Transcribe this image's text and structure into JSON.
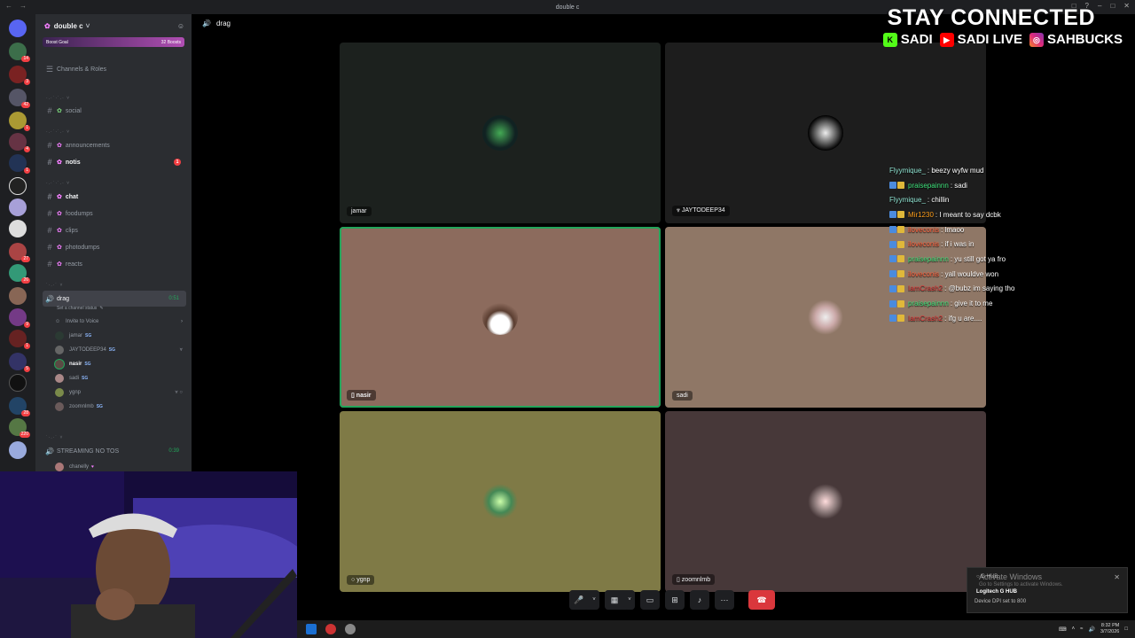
{
  "window": {
    "title": "double c"
  },
  "servers": [
    {
      "badge": ""
    },
    {
      "badge": "14"
    },
    {
      "badge": "3"
    },
    {
      "badge": "42"
    },
    {
      "badge": "1"
    },
    {
      "badge": "4"
    },
    {
      "badge": "1"
    },
    {
      "badge": ""
    },
    {
      "badge": "27"
    },
    {
      "badge": "26"
    },
    {
      "badge": ""
    },
    {
      "badge": "9"
    },
    {
      "badge": "1"
    },
    {
      "badge": "5"
    },
    {
      "badge": "8"
    },
    {
      "badge": "28"
    },
    {
      "badge": ""
    },
    {
      "badge": "220"
    },
    {
      "badge": "12"
    }
  ],
  "sidebar": {
    "guild_name": "double c",
    "boost_left": "Boost Goal",
    "boost_right": "32 Boosts",
    "channels_roles": "Channels & Roles",
    "channels": {
      "social": "social",
      "announcements": "announcements",
      "notis": "notis",
      "notis_mentions": "1",
      "chat": "chat",
      "foodumps": "foodumps",
      "clips": "clips",
      "photodumps": "photodumps",
      "reacts": "reacts"
    },
    "voice": {
      "name": "drag",
      "timer": "0:51",
      "status_prompt": "Set a channel status",
      "invite": "Invite to Voice",
      "members": [
        {
          "name": "jamar",
          "tag": "SG"
        },
        {
          "name": "JAYTODEEP34",
          "tag": "SG"
        },
        {
          "name": "nasir",
          "tag": "SG"
        },
        {
          "name": "sadi",
          "tag": "SG"
        },
        {
          "name": "ygnp",
          "tag": ""
        },
        {
          "name": "zoomnlmb",
          "tag": "SG"
        }
      ]
    },
    "voice2": {
      "name": "STREAMING NO TOS",
      "timer": "0:39",
      "member": "chanelly"
    }
  },
  "call": {
    "channel": "drag",
    "tiles": [
      {
        "name": "jamar",
        "bg": "#1c211e"
      },
      {
        "name": "JAYTODEEP34",
        "bg": "#1d1d1d"
      },
      {
        "name": "nasir",
        "bg": "#8c6b5d"
      },
      {
        "name": "sadi",
        "bg": "#8f7766"
      },
      {
        "name": "ygnp",
        "bg": "#7f7a46"
      },
      {
        "name": "zoomnlmb",
        "bg": "#473839"
      }
    ]
  },
  "overlay": {
    "headline": "STAY CONNECTED",
    "kick": "SADI",
    "youtube": "SADI LIVE",
    "instagram": "SAHBUCKS"
  },
  "chat": [
    {
      "user": "Flyymique_",
      "text": ": beezy wyfw mud",
      "color": "#8fe3d1"
    },
    {
      "user": "praisepainnn",
      "text": ": sadi",
      "color": "#3ee07a"
    },
    {
      "user": "Flyymique_",
      "text": ": chillin",
      "color": "#8fe3d1"
    },
    {
      "user": "Mir1230",
      "text": ": I meant to say dcbk",
      "color": "#ff9f1c"
    },
    {
      "user": "iloveconis",
      "text": ": lmaoo",
      "color": "#ff5e3a"
    },
    {
      "user": "iloveconis",
      "text": ": if i was in",
      "color": "#ff5e3a"
    },
    {
      "user": "praisepainnn",
      "text": ": yu still got ya fro",
      "color": "#3ee07a"
    },
    {
      "user": "iloveconis",
      "text": ": yall wouldve won",
      "color": "#ff5e3a"
    },
    {
      "user": "IamCrash2",
      "text": ": @bubz im saying tho",
      "color": "#e03a3a"
    },
    {
      "user": "praisepainnn",
      "text": ": give it to me",
      "color": "#3ee07a"
    },
    {
      "user": "IamCrash2",
      "text": ": ifg u are....",
      "color": "#e03a3a"
    }
  ],
  "toast": {
    "app": "G HUB",
    "title": "Logitech G HUB",
    "body": "Device DPI set to 800"
  },
  "activate": {
    "title": "Activate Windows",
    "sub": "Go to Settings to activate Windows."
  },
  "taskbar": {
    "time": "8:32 PM",
    "date": "3/7/2026"
  }
}
